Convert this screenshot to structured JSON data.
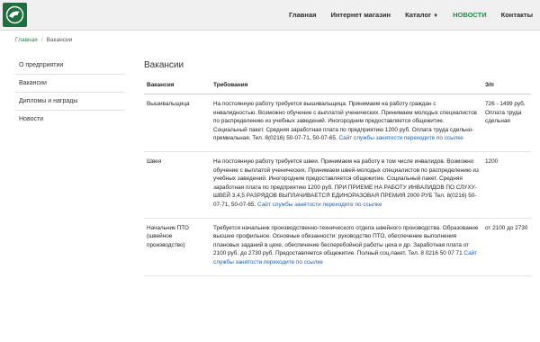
{
  "navbar": {
    "logo_icon": "eagle-logo-icon",
    "items": [
      {
        "label": "Главная"
      },
      {
        "label": "Интернет магазин"
      },
      {
        "label": "Каталог"
      },
      {
        "label": "НОВОСТИ"
      },
      {
        "label": "Контакты"
      }
    ],
    "active_color": "#1e8a47"
  },
  "breadcrumb": {
    "home": "Главная",
    "current": "Вакансии"
  },
  "sidebar": {
    "items": [
      {
        "label": "О предприятии"
      },
      {
        "label": "Вакансии"
      },
      {
        "label": "Дипломы и награды"
      },
      {
        "label": "Новости"
      }
    ]
  },
  "main": {
    "title": "Вакансии",
    "columns": [
      "Вакансия",
      "Требования",
      "З/п"
    ],
    "rows": [
      {
        "position": "Вышивальщица",
        "requirements": "На постоянную работу требуется вышивальщица. Принимаем на работу граждан с инвалидностью. Возможно обучение с выплатой ученических. Принимаем молодых специалистов по распределению из учебных заведений. Иногородним предоставляется общежитие. Социальный пакет. Средняя заработная плата по предприятию 1200 руб. Оплата труда сдельно-премиальная. Тел. 8(0216) 50-07-71, 50-07-65.",
        "link": "Сайт службы занятости переходите по ссылке",
        "salary": "726 - 1499 руб. Оплата труда сдельная"
      },
      {
        "position": "Швея",
        "requirements": "На постоянную работу требуется швеи. Принимаем на работу в том числе инвалидов. Возможно обучение с выплатой ученических. Принимаем швей-молодых специалистов по распределению из учебных заведений. Иногородним предоставляется общежитие. Социальный пакет. Средняя заработная плата по предприятию 1200 руб. ПРИ ПРИЕМЕ НА РАБОТУ ИНВАЛИДОВ ПО СЛУХУ-ШВЕЙ 3,4,5 РАЗРЯДОВ ВЫПЛАЧИВАЕТСЯ ЕДИНОРАЗОВАЯ ПРЕМИЯ 2000 РУБ Тел. 8(0216) 50-07-71, 50-07-65.",
        "link": "Сайт службы занятости переходите по ссылке",
        "salary": "1200"
      },
      {
        "position": "Начальник ПТО (швейное производство)",
        "requirements": "Требуется начальник производственно-технического отдела швейного производства. Образование высшее профильное. Основные обязанности: руководство ПТО, обеспечение выполнения плановых заданий в цехе, обеспечение бесперебойной работы цеха и др. Заработная плата от 2100 руб. до 2730 руб. Предоставляется общежитие. Полный соц.пакет. Тел. 8 0216 50 07 71",
        "link": "Сайт службы занятости переходите по ссылке",
        "salary": "от 2100 до 2730"
      }
    ]
  }
}
